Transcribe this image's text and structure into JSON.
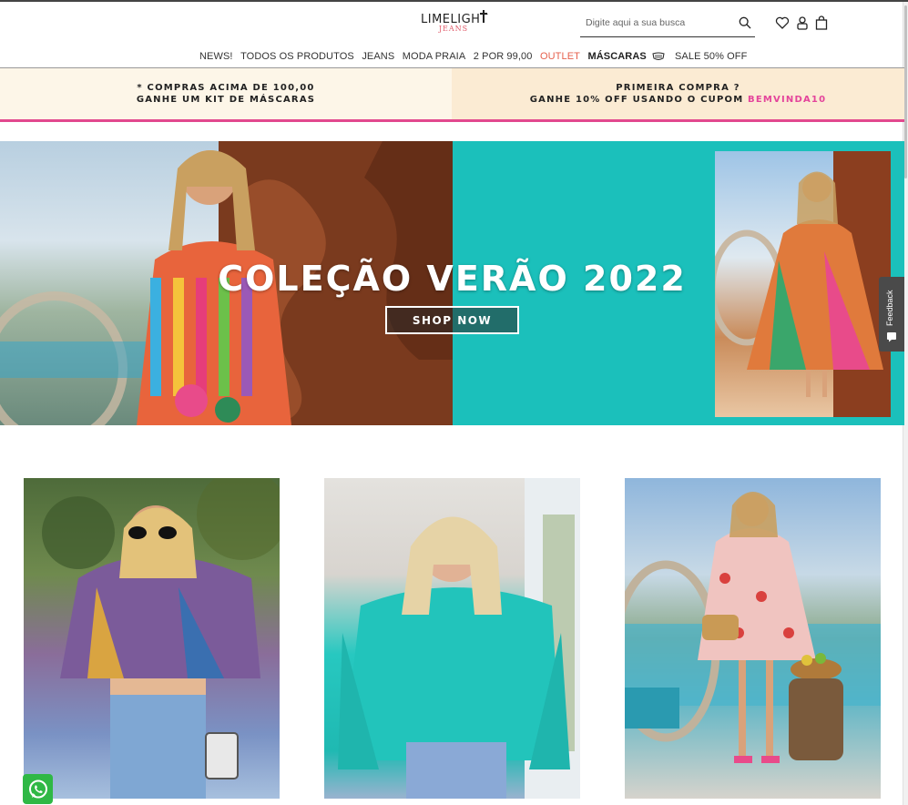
{
  "header": {
    "logo_main": "LIMELIGHT",
    "logo_sub": "JEANS",
    "search_placeholder": "Digite aqui a sua busca",
    "icons": [
      "search-icon",
      "heart-icon",
      "user-icon",
      "bag-icon"
    ]
  },
  "nav": {
    "items": [
      {
        "label": "NEWS!"
      },
      {
        "label": "TODOS OS PRODUTOS"
      },
      {
        "label": "JEANS"
      },
      {
        "label": "MODA PRAIA"
      },
      {
        "label": "2 POR 99,00"
      },
      {
        "label": "OUTLET"
      },
      {
        "label": "MÁSCARAS"
      },
      {
        "label": "SALE 50% OFF"
      }
    ],
    "outlet_color": "#e6604c"
  },
  "promo": {
    "left_line1": "* COMPRAS ACIMA DE 100,00",
    "left_line2": "GANHE UM KIT DE MÁSCARAS",
    "right_line1": "PRIMEIRA COMPRA ?",
    "right_line2_prefix": "GANHE 10% OFF USANDO O CUPOM ",
    "coupon_code": "BEMVINDA10",
    "coupon_color": "#e4449b",
    "underline_color": "#e2488e"
  },
  "hero": {
    "title": "COLEÇÃO VERÃO 2022",
    "button_label": "SHOP NOW",
    "accent_color": "#1bc0bb"
  },
  "feedback": {
    "label": "Feedback"
  }
}
